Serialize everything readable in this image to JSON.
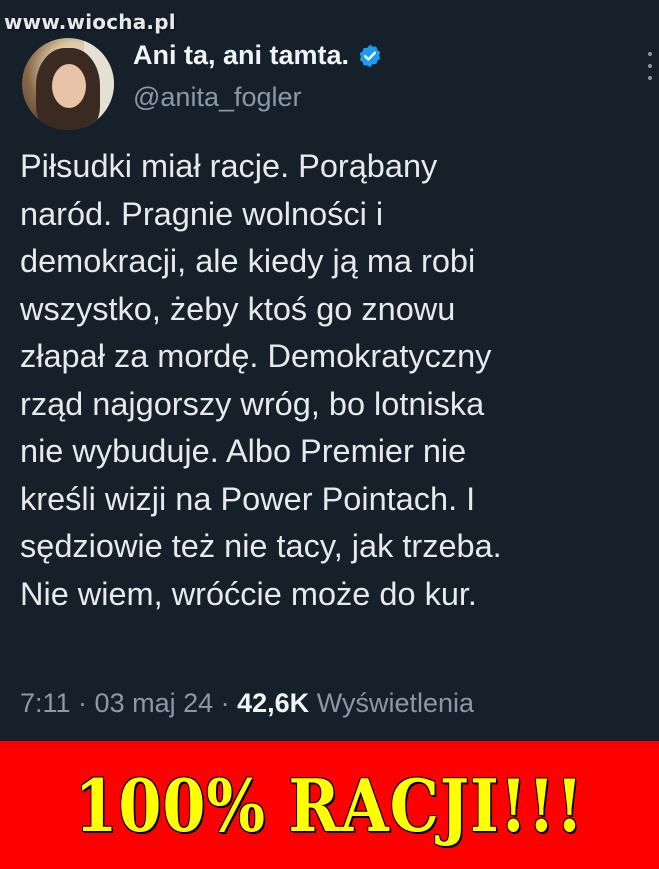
{
  "watermark": "www.wiocha.pl",
  "author": {
    "display_name": "Ani ta, ani tamta.",
    "handle": "@anita_fogler",
    "verified_icon": "verified-badge-icon"
  },
  "tweet": {
    "text": "Piłsudki miał racje. Porąbany\nnaród. Pragnie wolności i\ndemokracji, ale kiedy ją ma robi\nwszystko, żeby ktoś go znowu\nzłapał za mordę. Demokratyczny\nrząd najgorszy wróg, bo lotniska\nnie wybuduje. Albo Premier nie\nkreśli wizji na Power Pointach. I\nsędziowie też nie tacy, jak trzeba.\nNie wiem, wróćcie może do kur.",
    "time": "7:11",
    "separator": " · ",
    "date": "03 maj 24",
    "views_count": "42,6K",
    "views_label": "Wyświetlenia"
  },
  "banner": {
    "text": "100% RACJI!!!"
  },
  "colors": {
    "tweet_background": "#15202b",
    "banner_background": "#ff0000",
    "banner_text": "#ffff00",
    "verified": "#1d9bf0"
  }
}
